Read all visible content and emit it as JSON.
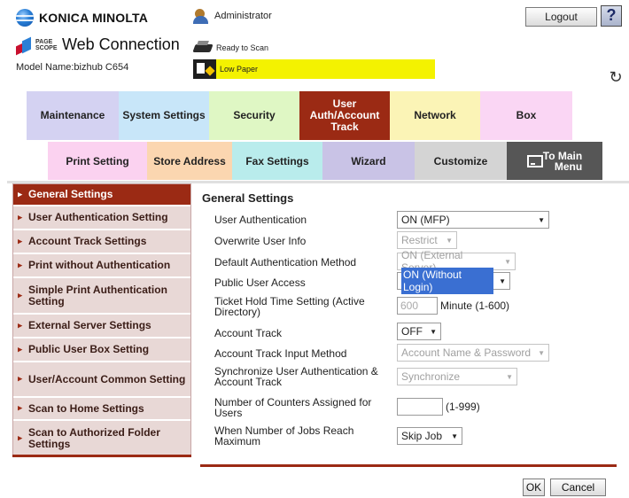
{
  "header": {
    "brand": "KONICA MINOLTA",
    "pagescope_mark": "PAGE SCOPE",
    "app_title": "Web Connection",
    "model_name": "Model Name:bizhub C654",
    "user": "Administrator",
    "status_ready": "Ready to Scan",
    "status_paper": "Low Paper",
    "paper_bar_color": "#f4f200",
    "logout_label": "Logout",
    "help_label": "?",
    "refresh_icon": "↻"
  },
  "tabs_primary": [
    {
      "label": "Maintenance",
      "color": "#d4d2f2"
    },
    {
      "label": "System Settings",
      "color": "#c8e6f9"
    },
    {
      "label": "Security",
      "color": "#dff7c4"
    },
    {
      "label": "User\nAuth/Account\nTrack",
      "color": "#9b2a14",
      "active": true
    },
    {
      "label": "Network",
      "color": "#fbf4b6"
    },
    {
      "label": "Box",
      "color": "#fad6f4"
    }
  ],
  "tabs_secondary": [
    {
      "label": "Print Setting",
      "color": "#fbd2f0"
    },
    {
      "label": "Store Address",
      "color": "#fbd6b0"
    },
    {
      "label": "Fax Settings",
      "color": "#b9ecec"
    },
    {
      "label": "Wizard",
      "color": "#c9c3e6"
    },
    {
      "label": "Customize",
      "color": "#d4d4d4"
    },
    {
      "label": "To Main\nMenu",
      "color": "#565656"
    }
  ],
  "sidebar": {
    "items": [
      {
        "label": "General Settings",
        "active": true
      },
      {
        "label": "User Authentication Setting"
      },
      {
        "label": "Account Track Settings"
      },
      {
        "label": "Print without Authentication"
      },
      {
        "label": "Simple Print Authentication Setting"
      },
      {
        "label": "External Server Settings"
      },
      {
        "label": "Public User Box Setting"
      },
      {
        "label": "User/Account Common Setting"
      },
      {
        "label": "Scan to Home Settings"
      },
      {
        "label": "Scan to Authorized Folder Settings"
      }
    ]
  },
  "main": {
    "title": "General Settings",
    "fields": [
      {
        "label": "User Authentication",
        "value": "ON (MFP)"
      },
      {
        "label": "Overwrite User Info",
        "value": "Restrict"
      },
      {
        "label": "Default Authentication Method",
        "value": "ON (External Server)"
      },
      {
        "label": "Public User Access",
        "value": "ON (Without Login)"
      },
      {
        "label": "Ticket Hold Time Setting (Active Directory)",
        "value": "600",
        "unit": "Minute (1-600)"
      },
      {
        "label": "Account Track",
        "value": "OFF"
      },
      {
        "label": "Account Track Input Method",
        "value": "Account Name & Password"
      },
      {
        "label": "Synchronize User Authentication & Account Track",
        "value": "Synchronize"
      },
      {
        "label": "Number of Counters Assigned for Users",
        "value": "",
        "unit": "(1-999)"
      },
      {
        "label": "When Number of Jobs Reach Maximum",
        "value": "Skip Job"
      }
    ],
    "ok_label": "OK",
    "cancel_label": "Cancel"
  },
  "colors": {
    "accent": "#9b2a14",
    "sidebar_bg": "#e8d8d6",
    "selection": "#3a6fd2"
  }
}
